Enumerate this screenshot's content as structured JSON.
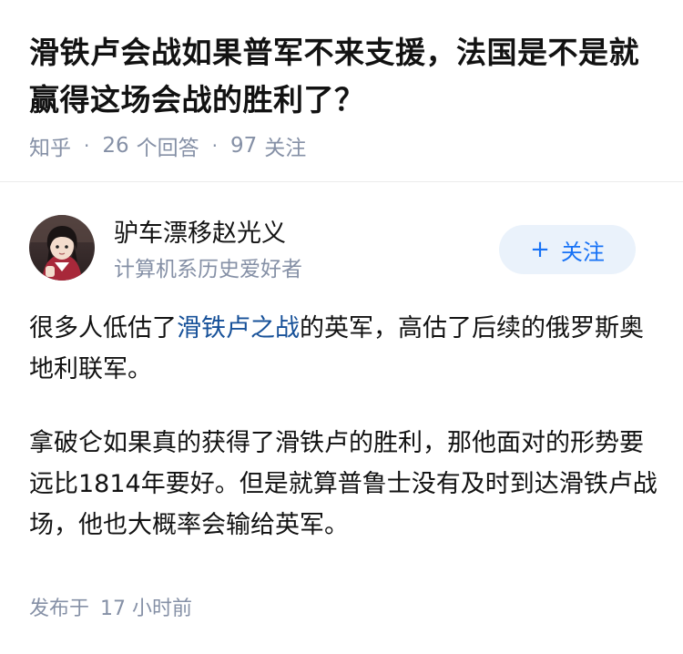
{
  "question": {
    "title": "滑铁卢会战如果普军不来支援，法国是不是就赢得这场会战的胜利了？",
    "source": "知乎",
    "answers_count": "26",
    "answers_label": "个回答",
    "followers_count": "97",
    "followers_label": "关注"
  },
  "author": {
    "name": "驴车漂移赵光义",
    "bio": "计算机系历史爱好者",
    "follow_plus": "+",
    "follow_label": "关注"
  },
  "answer": {
    "p1_before": "很多人低估了",
    "p1_link": "滑铁卢之战",
    "p1_after": "的英军，高估了后续的俄罗斯奥地利联军。",
    "p2": "拿破仑如果真的获得了滑铁卢的胜利，那他面对的形势要远比1814年要好。但是就算普鲁士没有及时到达滑铁卢战场，他也大概率会输给英军。"
  },
  "footer": {
    "published_label": "发布于",
    "published_time": "17 小时前"
  },
  "colors": {
    "meta_gray": "#8590a6",
    "link_blue": "#175199",
    "follow_blue": "#1772f6",
    "follow_bg": "#eaf2fb"
  }
}
